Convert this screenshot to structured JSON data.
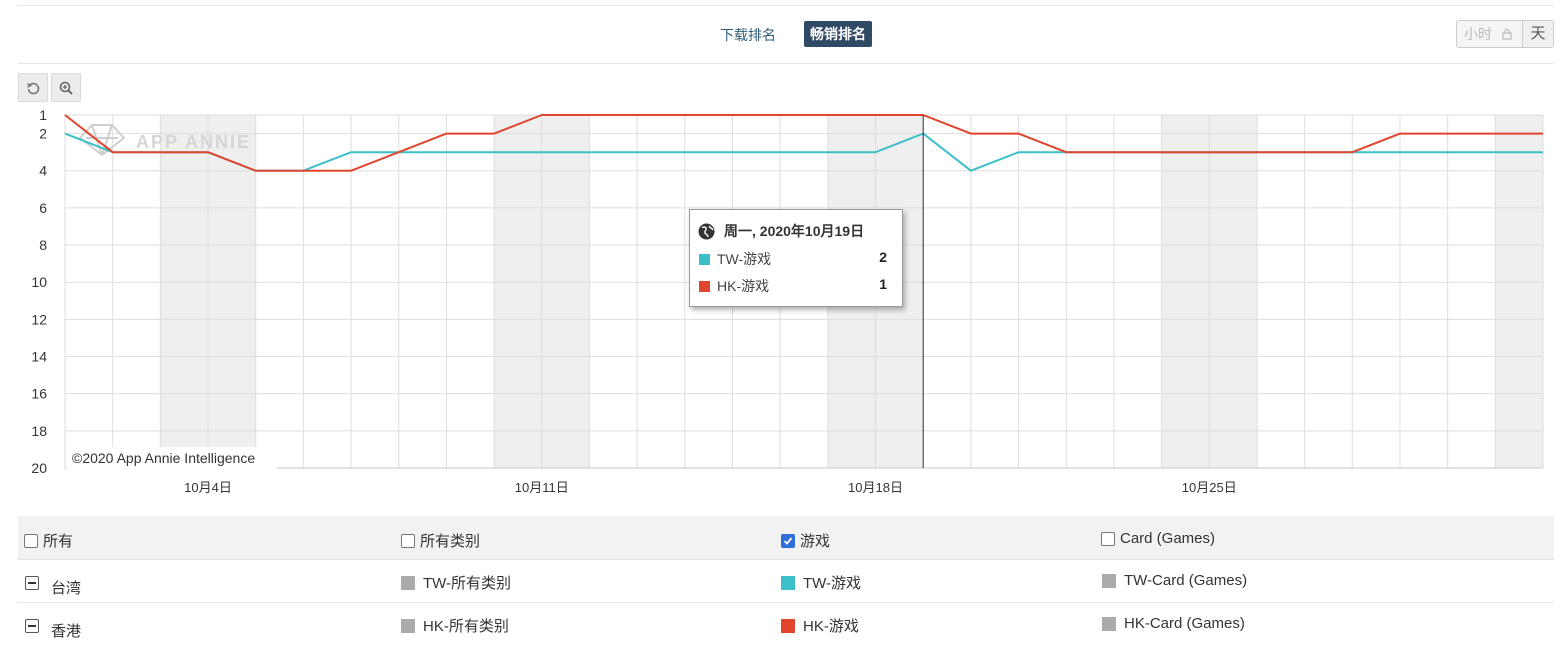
{
  "tabs": {
    "download_label": "下载排名",
    "grossing_label": "畅销排名"
  },
  "granularity": {
    "hour_label": "小时",
    "day_label": "天"
  },
  "toolbar": {
    "reset_icon": "undo-icon",
    "zoom_icon": "zoom-in-icon"
  },
  "watermark": "APP ANNIE",
  "copyright": "©2020 App Annie Intelligence",
  "tooltip": {
    "date": "周一, 2020年10月19日",
    "rows": [
      {
        "label": "TW-游戏",
        "value": "2",
        "color": "#3dbfc9"
      },
      {
        "label": "HK-游戏",
        "value": "1",
        "color": "#e0462e"
      }
    ]
  },
  "chart_data": {
    "type": "line",
    "title": "",
    "xlabel": "",
    "ylabel": "",
    "y_reversed": true,
    "ylim": [
      1,
      20
    ],
    "yticks": [
      "1",
      "2",
      "4",
      "6",
      "8",
      "10",
      "12",
      "14",
      "16",
      "18",
      "20"
    ],
    "x": [
      "2020-10-01",
      "2020-10-02",
      "2020-10-03",
      "2020-10-04",
      "2020-10-05",
      "2020-10-06",
      "2020-10-07",
      "2020-10-08",
      "2020-10-09",
      "2020-10-10",
      "2020-10-11",
      "2020-10-12",
      "2020-10-13",
      "2020-10-14",
      "2020-10-15",
      "2020-10-16",
      "2020-10-17",
      "2020-10-18",
      "2020-10-19",
      "2020-10-20",
      "2020-10-21",
      "2020-10-22",
      "2020-10-23",
      "2020-10-24",
      "2020-10-25",
      "2020-10-26",
      "2020-10-27",
      "2020-10-28",
      "2020-10-29",
      "2020-10-30",
      "2020-10-31",
      "2020-11-01"
    ],
    "xtick_labels": [
      {
        "x": "2020-10-04",
        "label": "10月4日"
      },
      {
        "x": "2020-10-11",
        "label": "10月11日"
      },
      {
        "x": "2020-10-18",
        "label": "10月18日"
      },
      {
        "x": "2020-10-25",
        "label": "10月25日"
      }
    ],
    "weekend_bands": [
      [
        "2020-10-03",
        "2020-10-05"
      ],
      [
        "2020-10-10",
        "2020-10-12"
      ],
      [
        "2020-10-17",
        "2020-10-19"
      ],
      [
        "2020-10-24",
        "2020-10-26"
      ],
      [
        "2020-10-31",
        "2020-11-01"
      ]
    ],
    "crosshair_x": "2020-10-19",
    "series": [
      {
        "name": "TW-游戏",
        "color": "#3dbfc9",
        "values": [
          2,
          3,
          3,
          3,
          4,
          4,
          3,
          3,
          3,
          3,
          3,
          3,
          3,
          3,
          3,
          3,
          3,
          3,
          2,
          4,
          3,
          3,
          3,
          3,
          3,
          3,
          3,
          3,
          3,
          3,
          3,
          3
        ]
      },
      {
        "name": "HK-游戏",
        "color": "#e0462e",
        "values": [
          1,
          3,
          3,
          3,
          4,
          4,
          4,
          3,
          2,
          2,
          1,
          1,
          1,
          1,
          1,
          1,
          1,
          1,
          1,
          2,
          2,
          3,
          3,
          3,
          3,
          3,
          3,
          3,
          2,
          2,
          2,
          2
        ]
      }
    ]
  },
  "legend": {
    "header": [
      "所有",
      "所有类别",
      "游戏",
      "Card (Games)"
    ],
    "header_checked": [
      false,
      false,
      true,
      false
    ],
    "rows": [
      {
        "region": "台湾",
        "items": [
          {
            "label": "TW-所有类别",
            "color": "#aaaaaa"
          },
          {
            "label": "TW-游戏",
            "color": "#3dbfc9"
          },
          {
            "label": "TW-Card (Games)",
            "color": "#aaaaaa"
          }
        ]
      },
      {
        "region": "香港",
        "items": [
          {
            "label": "HK-所有类别",
            "color": "#aaaaaa"
          },
          {
            "label": "HK-游戏",
            "color": "#e0462e"
          },
          {
            "label": "HK-Card (Games)",
            "color": "#aaaaaa"
          }
        ]
      }
    ]
  }
}
